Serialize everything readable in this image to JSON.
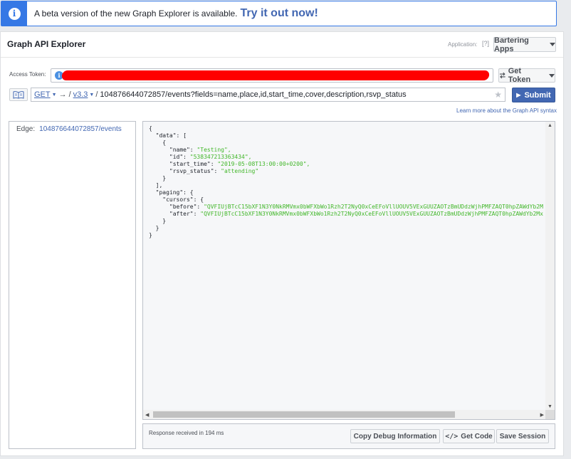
{
  "banner": {
    "text": "A beta version of the new Graph Explorer is available.",
    "link": "Try it out now!"
  },
  "header": {
    "title": "Graph API Explorer",
    "application_label": "Application:",
    "help_label": "[?]",
    "app_button": "Bartering Apps"
  },
  "token": {
    "label": "Access Token:",
    "get_token_button": "Get Token"
  },
  "query": {
    "method": "GET",
    "arrow": "→",
    "slash": "/",
    "version": "v3.3",
    "path": "104876644072857/events?fields=name,place,id,start_time,cover,description,rsvp_status",
    "submit_label": "Submit"
  },
  "learn_link": "Learn more about the Graph API syntax",
  "edge": {
    "label": "Edge:",
    "value": "104876644072857/events"
  },
  "response": {
    "line_01": "{",
    "line_02": "  \"data\": [",
    "line_03": "    {",
    "line_04_key": "      \"name\": ",
    "line_04_val": "\"Testing\",",
    "line_05_key": "      \"id\": ",
    "line_05_val": "\"538347213363434\",",
    "line_06_key": "      \"start_time\": ",
    "line_06_val": "\"2019-05-08T13:00:00+0200\",",
    "line_07_key": "      \"rsvp_status\": ",
    "line_07_val": "\"attending\"",
    "line_08": "    }",
    "line_09": "  ],",
    "line_10": "  \"paging\": {",
    "line_11": "    \"cursors\": {",
    "line_12_key": "      \"before\": ",
    "line_12_val": "\"QVFIUjBTcC15bXF1N3Y0NkRMVmx0bWFXbWo1Rzh2T2NyQ0xCeEFoVllUOUV5VExGUUZAOTzBmUDdzWjhPMFZAQT0hpZAWdYb2M",
    "line_13_key": "      \"after\": ",
    "line_13_val": "\"QVFIUjBTcC15bXF1N3Y0NkRMVmx0bWFXbWo1Rzh2T2NyQ0xCeEFoVllUOUV5VExGUUZAOTzBmUDdzWjhPMFZAQT0hpZAWdYb2Mx",
    "line_14": "    }",
    "line_15": "  }",
    "line_16": "}",
    "status": "Response received in 194 ms"
  },
  "footer_buttons": {
    "copy_debug": "Copy Debug Information",
    "get_code": "Get Code",
    "save_session": "Save Session"
  }
}
